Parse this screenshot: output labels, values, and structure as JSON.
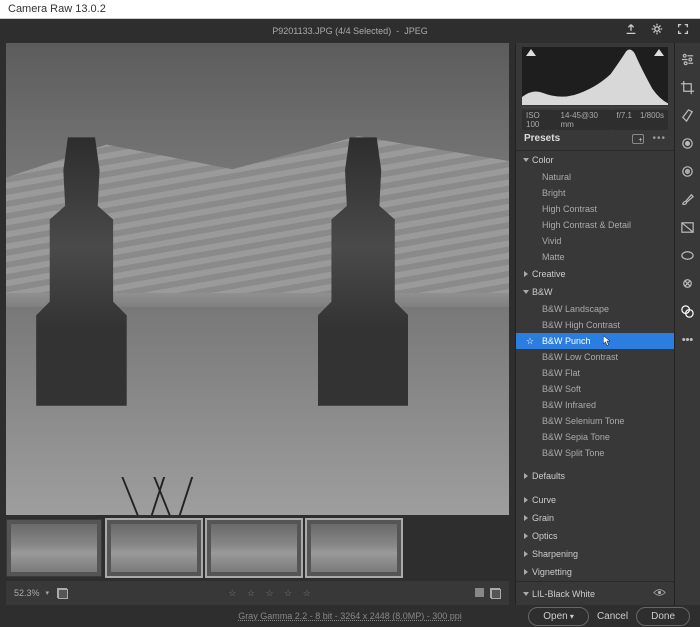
{
  "window": {
    "title": "Camera Raw 13.0.2"
  },
  "topbar": {
    "filename": "P9201133.JPG (4/4 Selected)",
    "format": "JPEG"
  },
  "histogram": {
    "iso": "ISO 100",
    "focal": "14-45@30 mm",
    "aperture": "f/7.1",
    "shutter": "1/800s"
  },
  "panel": {
    "title": "Presets",
    "bottom_label": "LIL-Black White"
  },
  "sections": {
    "color": {
      "label": "Color",
      "open": true,
      "items": [
        "Natural",
        "Bright",
        "High Contrast",
        "High Contrast & Detail",
        "Vivid",
        "Matte"
      ]
    },
    "creative": {
      "label": "Creative",
      "open": false
    },
    "bw": {
      "label": "B&W",
      "open": true,
      "items": [
        "B&W Landscape",
        "B&W High Contrast",
        "B&W Punch",
        "B&W Low Contrast",
        "B&W Flat",
        "B&W Soft",
        "B&W Infrared",
        "B&W Selenium Tone",
        "B&W Sepia Tone",
        "B&W Split Tone"
      ],
      "selected": "B&W Punch"
    },
    "defaults": {
      "label": "Defaults",
      "open": false
    },
    "curve": {
      "label": "Curve",
      "open": false
    },
    "grain": {
      "label": "Grain",
      "open": false
    },
    "optics": {
      "label": "Optics",
      "open": false
    },
    "sharpening": {
      "label": "Sharpening",
      "open": false
    },
    "vignetting": {
      "label": "Vignetting",
      "open": false
    }
  },
  "filmstrip": {
    "count": 4,
    "selected_index": 1
  },
  "bottombar": {
    "zoom": "52.3%",
    "stars": "☆ ☆ ☆ ☆ ☆"
  },
  "statusbar": {
    "info": "Gray Gamma 2.2 - 8 bit - 3264 x 2448 (8.0MP) - 300 ppi",
    "open": "Open",
    "cancel": "Cancel",
    "done": "Done"
  },
  "tools": [
    "edit",
    "crop",
    "spot",
    "eye",
    "mask",
    "brush",
    "grad",
    "radial",
    "redeye",
    "presets",
    "more"
  ]
}
